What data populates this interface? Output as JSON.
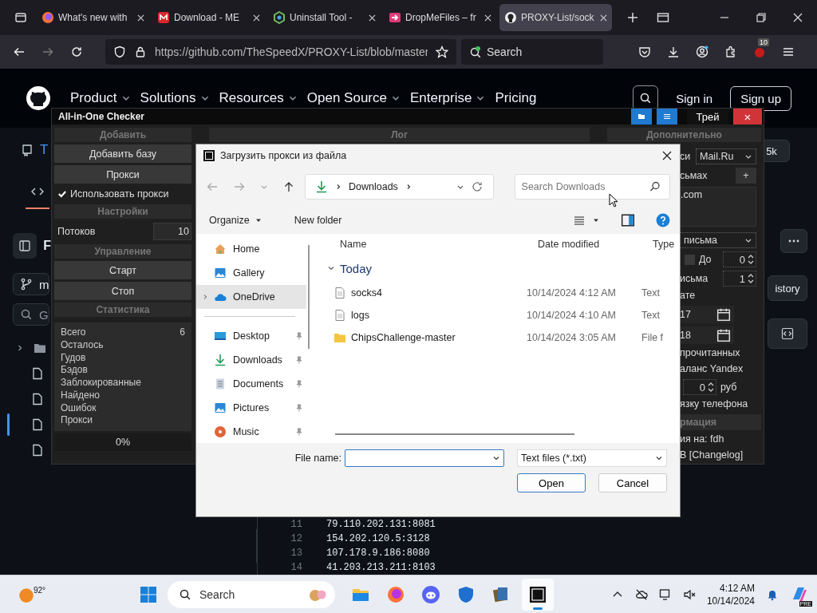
{
  "browser": {
    "tabs": [
      {
        "title": "What's new with",
        "selected": false
      },
      {
        "title": "Download - ME",
        "selected": false
      },
      {
        "title": "Uninstall Tool - ",
        "selected": false
      },
      {
        "title": "DropMeFiles – fr",
        "selected": false
      },
      {
        "title": "PROXY-List/sock",
        "selected": true
      }
    ],
    "address": "https://github.com/TheSpeedX/PROXY-List/blob/master",
    "search_placeholder": "Search",
    "extension_badge": "10"
  },
  "github_header": {
    "nav": [
      "Product",
      "Solutions",
      "Resources",
      "Open Source",
      "Enterprise",
      "Pricing"
    ],
    "sign_in": "Sign in",
    "sign_up": "Sign up"
  },
  "github_page": {
    "repo_initial": "T",
    "panel_initial": "F",
    "branch_initial": "m",
    "search_initial": "G",
    "star_count": "5k",
    "history": "istory",
    "code_lines": [
      {
        "number": "11",
        "text": "79.110.202.131:8081"
      },
      {
        "number": "12",
        "text": "154.202.120.5:3128"
      },
      {
        "number": "13",
        "text": "107.178.9.186:8080"
      },
      {
        "number": "14",
        "text": "41.203.213.211:8103"
      }
    ]
  },
  "checker": {
    "title": "All-in-One Checker",
    "tray": "Трей",
    "close": "×",
    "log_header": "Лог",
    "extra_header": "Дополнительно",
    "left": [
      {
        "kind": "header",
        "label": "Добавить"
      },
      {
        "kind": "button",
        "label": "Добавить базу"
      },
      {
        "kind": "button",
        "label": "Прокси"
      },
      {
        "kind": "checkbox",
        "label": "Использовать прокси",
        "checked": true
      },
      {
        "kind": "header",
        "label": "Настройки"
      },
      {
        "kind": "field",
        "label": "Потоков",
        "value": "10"
      },
      {
        "kind": "header",
        "label": "Управление"
      },
      {
        "kind": "button",
        "label": "Старт"
      },
      {
        "kind": "button",
        "label": "Стоп"
      },
      {
        "kind": "header",
        "label": "Статистика"
      }
    ],
    "stats": [
      {
        "label": "Всего",
        "value": "6"
      },
      {
        "label": "Осталось"
      },
      {
        "label": "Гудов"
      },
      {
        "label": "Бэдов"
      },
      {
        "label": "Заблокированные"
      },
      {
        "label": "Найдено"
      },
      {
        "label": "Ошибок"
      },
      {
        "label": "Прокси"
      }
    ],
    "progress": "0%",
    "right": [
      {
        "kind": "select_row",
        "label": "си",
        "value": "Mail.Ru"
      },
      {
        "kind": "add_row",
        "label": "сьмах",
        "button": "+"
      },
      {
        "kind": "textarea",
        "value": ".com"
      },
      {
        "kind": "select",
        "value": "письма"
      },
      {
        "kind": "check_spin",
        "label": "До",
        "checked": false,
        "value": "0"
      },
      {
        "kind": "spin",
        "label": "исьма",
        "value": "1"
      },
      {
        "kind": "text",
        "label": "ате"
      },
      {
        "kind": "date",
        "value": "17"
      },
      {
        "kind": "date",
        "value": "18"
      },
      {
        "kind": "text",
        "label": "прочитанных"
      },
      {
        "kind": "text",
        "label": "аланс Yandex"
      },
      {
        "kind": "spin_unit",
        "value": "0",
        "unit": "руб"
      },
      {
        "kind": "text",
        "label": "язку телефона"
      },
      {
        "kind": "header",
        "label": "рмация"
      },
      {
        "kind": "text",
        "label": "ия на: fdh"
      },
      {
        "kind": "text",
        "label": "B [Changelog]"
      }
    ]
  },
  "dialog": {
    "title": "Загрузить прокси из файла",
    "breadcrumb": "Downloads",
    "search_placeholder": "Search Downloads",
    "organize": "Organize",
    "new_folder": "New folder",
    "nav": [
      {
        "label": "Home",
        "selected": false,
        "pinned": false
      },
      {
        "label": "Gallery",
        "selected": false,
        "pinned": false
      },
      {
        "label": "OneDrive",
        "selected": true,
        "pinned": false
      },
      {
        "label": "Desktop",
        "selected": false,
        "pinned": true
      },
      {
        "label": "Downloads",
        "selected": false,
        "pinned": true
      },
      {
        "label": "Documents",
        "selected": false,
        "pinned": true
      },
      {
        "label": "Pictures",
        "selected": false,
        "pinned": true
      },
      {
        "label": "Music",
        "selected": false,
        "pinned": true
      }
    ],
    "columns": [
      "Name",
      "Date modified",
      "Type"
    ],
    "group": "Today",
    "files": [
      {
        "name": "socks4",
        "kind": "file",
        "date": "10/14/2024 4:12 AM",
        "type": "Text"
      },
      {
        "name": "logs",
        "kind": "file",
        "date": "10/14/2024 4:10 AM",
        "type": "Text"
      },
      {
        "name": "ChipsChallenge-master",
        "kind": "folder",
        "date": "10/14/2024 3:05 AM",
        "type": "File f"
      }
    ],
    "file_name_label": "File name:",
    "filter": "Text files (*.txt)",
    "open": "Open",
    "cancel": "Cancel"
  },
  "taskbar": {
    "weather": "92°",
    "search": "Search",
    "time": "4:12 AM",
    "date": "10/14/2024",
    "copilot_badge": "PRE"
  }
}
